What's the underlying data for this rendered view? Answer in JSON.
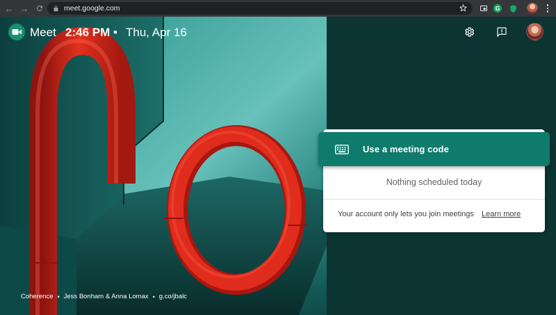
{
  "browser": {
    "url": "meet.google.com",
    "back_glyph": "←",
    "forward_glyph": "→",
    "ext_g_letter": "G"
  },
  "header": {
    "app_name": "Meet",
    "time": "2:46 PM",
    "separator": "•",
    "date": "Thu, Apr 16"
  },
  "card": {
    "code_button_label": "Use a meeting code",
    "empty_text": "Nothing scheduled today",
    "account_text": "Your account only lets you join meetings",
    "learn_more": "Learn more"
  },
  "credit": {
    "title": "Coherence",
    "sep1": "•",
    "artists": "Jess Bonham & Anna Lomax",
    "sep2": "•",
    "link": "g.co/jbalc"
  },
  "colors": {
    "accent": "#0f7b6c",
    "pipe_red": "#d8241c",
    "background_teal": "#125854"
  },
  "icons": [
    "back-arrow-icon",
    "forward-arrow-icon",
    "reload-icon",
    "lock-icon",
    "star-icon",
    "cast-icon",
    "grammarly-icon",
    "shield-icon",
    "meet-logo-icon",
    "gear-icon",
    "feedback-icon",
    "keyboard-icon"
  ]
}
